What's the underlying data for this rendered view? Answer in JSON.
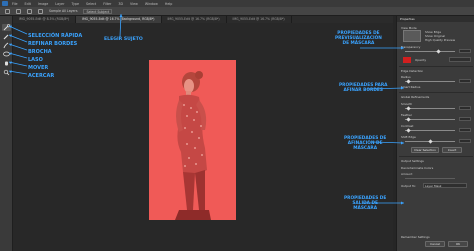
{
  "menu": [
    "File",
    "Edit",
    "Image",
    "Layer",
    "Type",
    "Select",
    "Filter",
    "3D",
    "View",
    "Window",
    "Help"
  ],
  "options_bar": {
    "sample_all_layers": "Sample All Layers",
    "select_subject": "Select Subject"
  },
  "tabs": [
    {
      "label": "IMG_9055-Edit @ 8.3% (RGB/8*)",
      "active": false
    },
    {
      "label": "IMG_9055-Edit @ 16.7% (Background, RGB/8*)",
      "active": true
    },
    {
      "label": "IMG_9055-Edit @ 16.7% (RGB/8*)",
      "active": false
    },
    {
      "label": "IMG_9055-Edit @ 16.7% (RGB/8*)",
      "active": false
    }
  ],
  "left_annotations": [
    "SELECCIÓN RÁPIDA",
    "REFINAR BORDES",
    "BROCHA",
    "LASO",
    "MOVER",
    "ACERCAR"
  ],
  "center_annotation": "ELEGIR SUJETO",
  "right_annotations": {
    "preview": "PROPIEDADES DE\nPREVISUALIZACIÓN\nDE MÁSCARA",
    "refine": "PROPIEDADES PARA\nAFINAR BORDES",
    "global": "PROPIEDADES DE\nAFINACIÓN DE\nMÁSCARA",
    "output": "PROPIEDADES DE\nSALIDA DE\nMÁSCARA"
  },
  "panel": {
    "title": "Properties",
    "view_mode": "View Mode",
    "show_edge": "Show Edge",
    "show_original": "Show Original",
    "high_quality_preview": "High Quality Preview",
    "transparency": "Transparency",
    "opacity": "Opacity",
    "edge_detection": "Edge Detection",
    "radius": "Radius",
    "smart_radius": "Smart Radius",
    "global_refinements": "Global Refinements",
    "smooth": "Smooth",
    "feather": "Feather",
    "contrast": "Contrast",
    "shift_edge": "Shift Edge",
    "clear_selection": "Clear Selection",
    "invert": "Invert",
    "output_settings": "Output Settings",
    "decontaminate_colors": "Decontaminate Colors",
    "amount": "Amount",
    "output_to": "Output To:",
    "output_value": "Layer Mask",
    "remember_settings": "Remember Settings",
    "cancel": "Cancel",
    "ok": "OK"
  },
  "colors": {
    "overlay_red": "#f05a57",
    "annotation_blue": "#3aa3ff",
    "panel_swatch": "#d21f1f"
  }
}
